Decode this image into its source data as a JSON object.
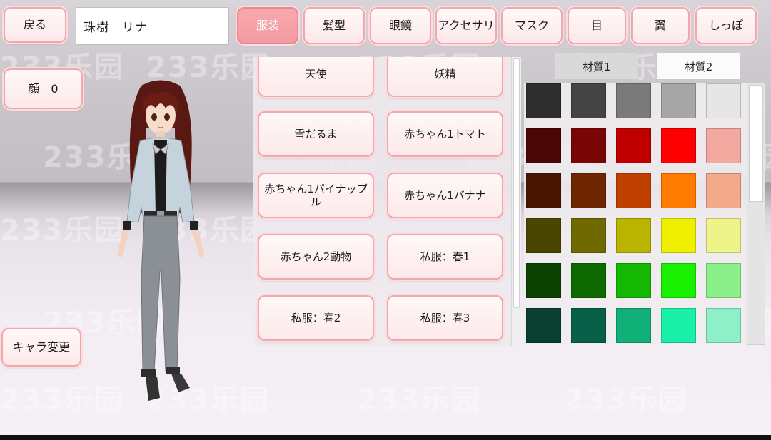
{
  "top_bar": {
    "back_label": "戻る",
    "name_value": "珠樹　リナ",
    "tabs": [
      {
        "label": "服装",
        "active": true
      },
      {
        "label": "髪型",
        "active": false
      },
      {
        "label": "眼鏡",
        "active": false
      },
      {
        "label": "アクセサリ",
        "active": false
      },
      {
        "label": "マスク",
        "active": false
      },
      {
        "label": "目",
        "active": false
      },
      {
        "label": "翼",
        "active": false
      },
      {
        "label": "しっぽ",
        "active": false
      }
    ]
  },
  "left_panel": {
    "face_label": "顔　0",
    "change_character_label": "キャラ変更"
  },
  "outfits": [
    {
      "label": "天使"
    },
    {
      "label": "妖精"
    },
    {
      "label": "雪だるま"
    },
    {
      "label": "赤ちゃん1トマト"
    },
    {
      "label": "赤ちゃん1パイナップル"
    },
    {
      "label": "赤ちゃん1バナナ"
    },
    {
      "label": "赤ちゃん2動物"
    },
    {
      "label": "私服：春1"
    },
    {
      "label": "私服：春2"
    },
    {
      "label": "私服：春3"
    }
  ],
  "material_tabs": [
    {
      "label": "材質1",
      "selected": true
    },
    {
      "label": "材質2",
      "selected": false
    }
  ],
  "colors": {
    "accent_pink": "#f39aa1",
    "swatches": [
      [
        "#2e2e2e",
        "#444444",
        "#7a7a7a",
        "#a6a6a6",
        "#e6e6e6"
      ],
      [
        "#4a0505",
        "#7a0505",
        "#c00000",
        "#ff0000",
        "#f3a8a0"
      ],
      [
        "#4a1500",
        "#6e2600",
        "#c04000",
        "#ff7a00",
        "#f3a98a"
      ],
      [
        "#4a4500",
        "#6e6a00",
        "#b8b400",
        "#eff000",
        "#eef48a"
      ],
      [
        "#0c4000",
        "#0e6a00",
        "#14b800",
        "#18f000",
        "#8cf08a"
      ],
      [
        "#0a4030",
        "#086048",
        "#10b078",
        "#18f0a8",
        "#8ef0c8"
      ]
    ]
  },
  "watermark_text": "233乐园"
}
